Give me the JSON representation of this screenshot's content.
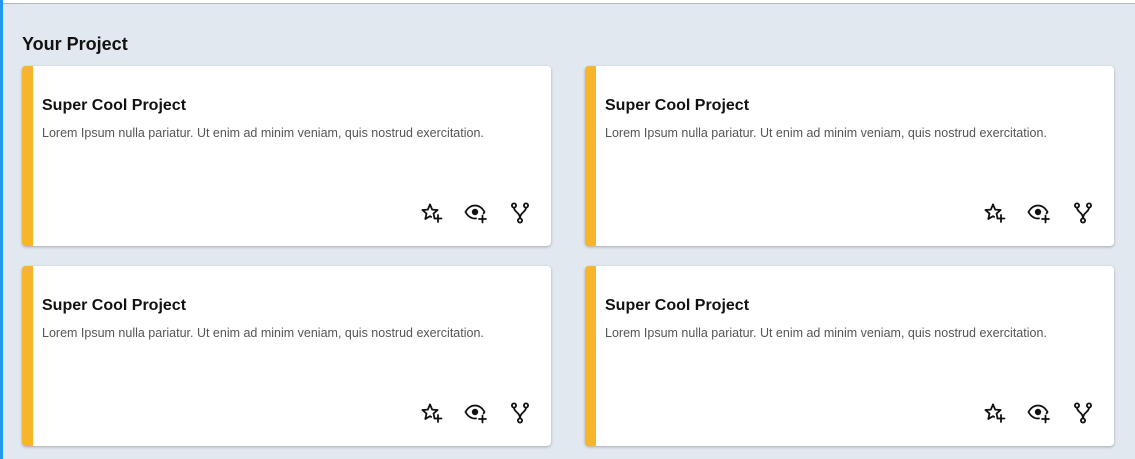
{
  "section": {
    "title": "Your Project"
  },
  "colors": {
    "accent": "#f6b52a",
    "background": "#e2e8f0",
    "left_edge": "#2196f3"
  },
  "cards": [
    {
      "title": "Super Cool Project",
      "description": "Lorem Ipsum nulla pariatur. Ut enim ad minim veniam, quis nostrud exercitation.",
      "actions": [
        "star-add-icon",
        "watch-add-icon",
        "fork-icon"
      ]
    },
    {
      "title": "Super Cool Project",
      "description": "Lorem Ipsum nulla pariatur. Ut enim ad minim veniam, quis nostrud exercitation.",
      "actions": [
        "star-add-icon",
        "watch-add-icon",
        "fork-icon"
      ]
    },
    {
      "title": "Super Cool Project",
      "description": "Lorem Ipsum nulla pariatur. Ut enim ad minim veniam, quis nostrud exercitation.",
      "actions": [
        "star-add-icon",
        "watch-add-icon",
        "fork-icon"
      ]
    },
    {
      "title": "Super Cool Project",
      "description": "Lorem Ipsum nulla pariatur. Ut enim ad minim veniam, quis nostrud exercitation.",
      "actions": [
        "star-add-icon",
        "watch-add-icon",
        "fork-icon"
      ]
    }
  ]
}
